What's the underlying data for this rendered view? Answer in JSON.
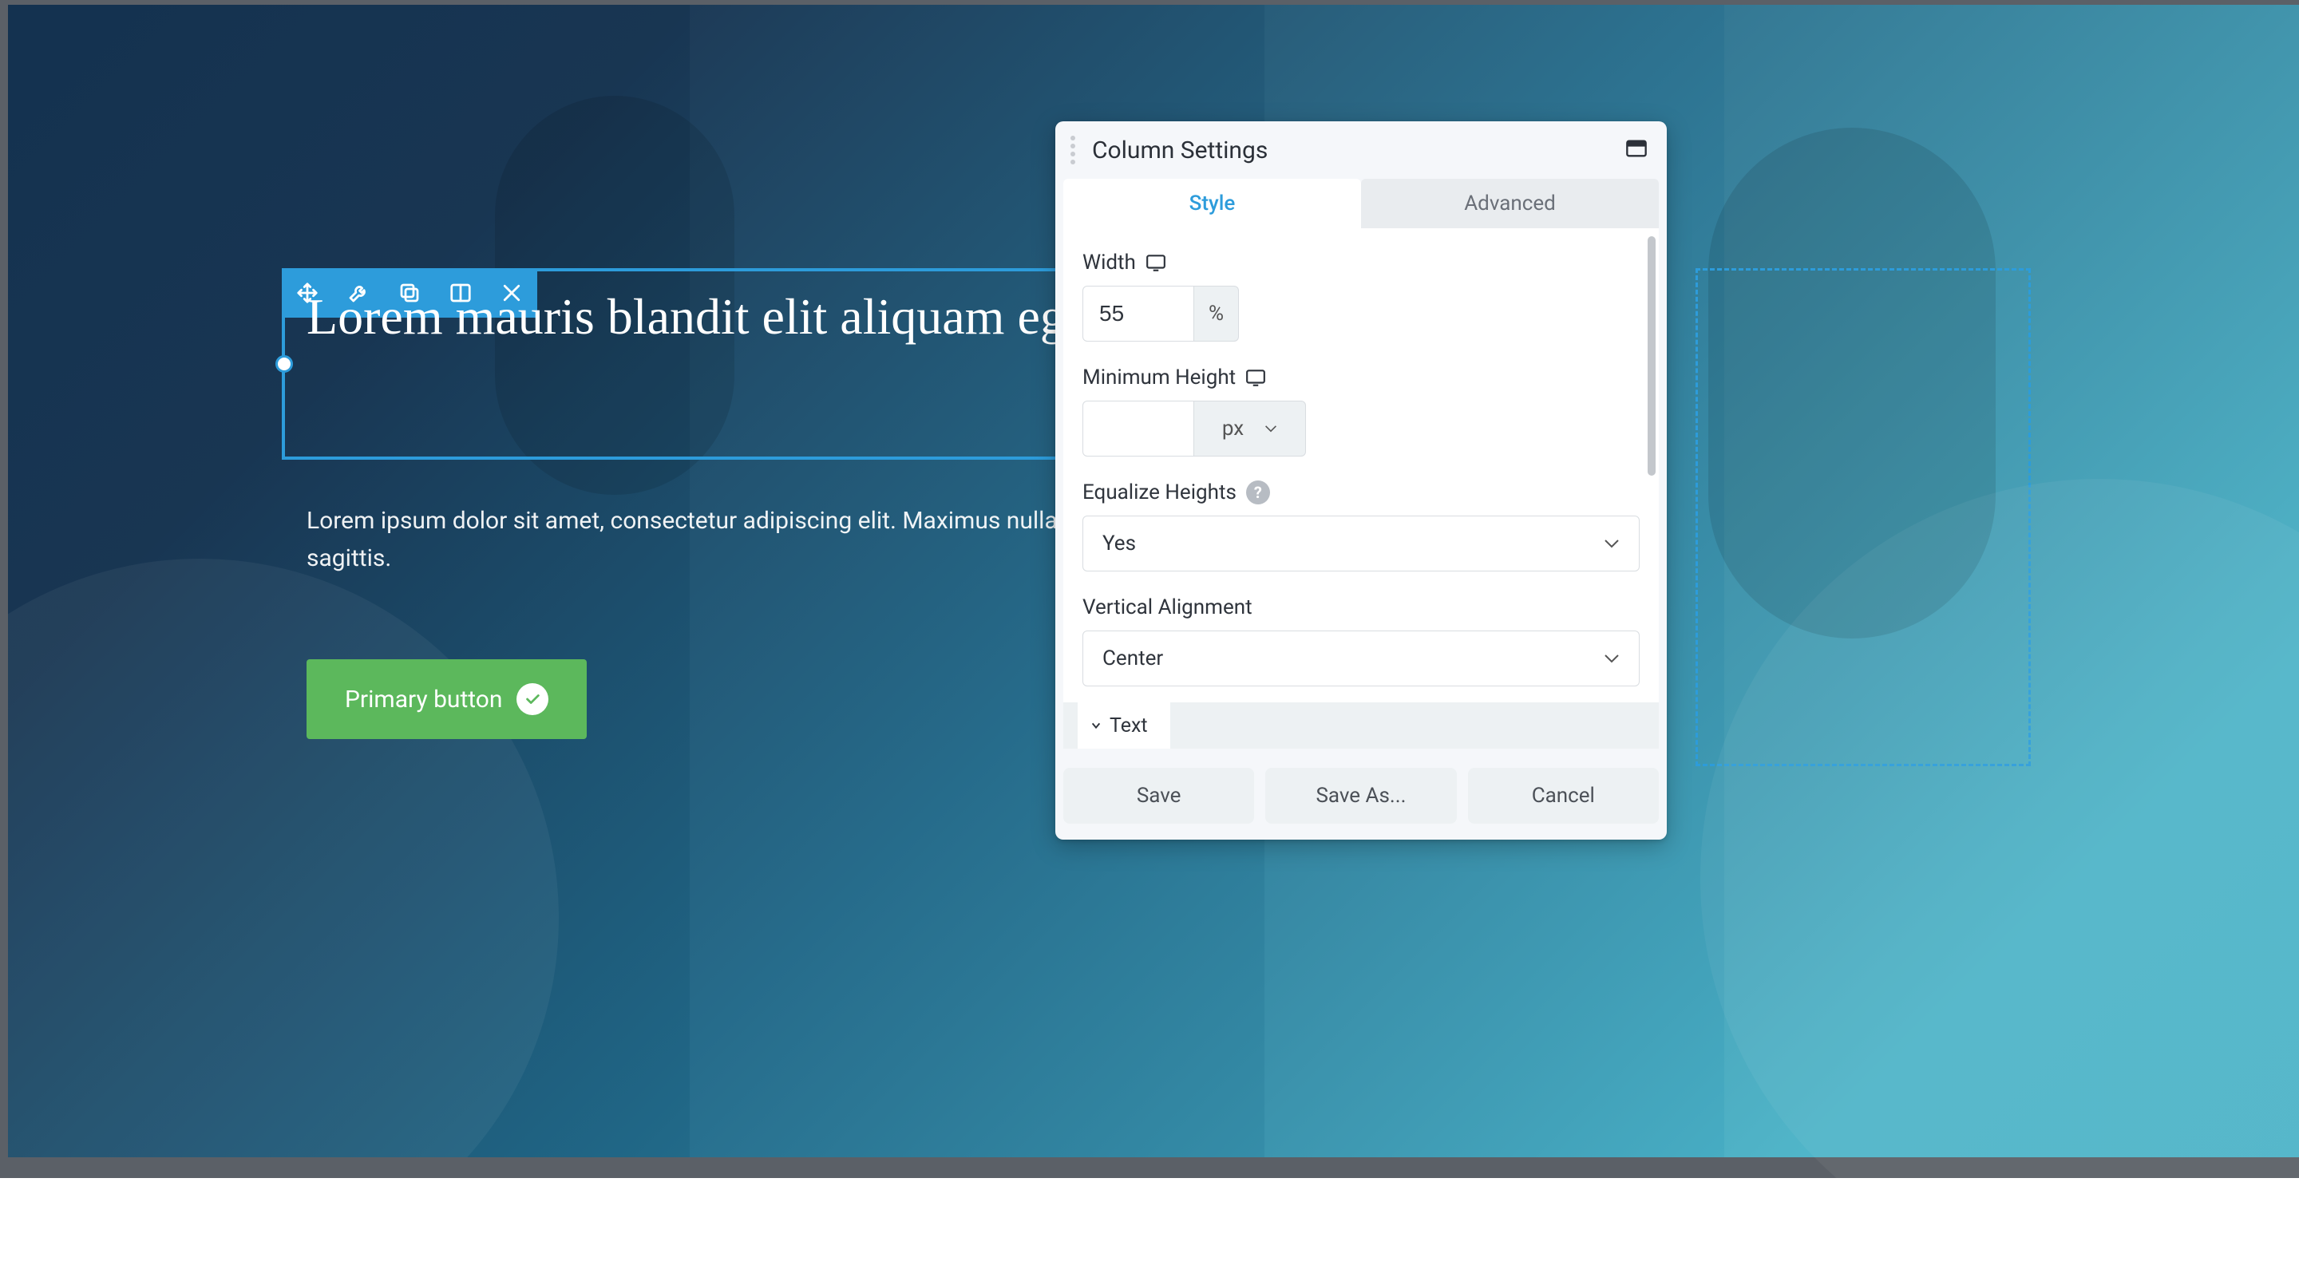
{
  "accent_color": "#2d9cdb",
  "button_color": "#5cb85c",
  "canvas": {
    "heading": "Lorem mauris blandit elit aliquam eget tincidunt",
    "paragraph": "Lorem ipsum dolor sit amet, consectetur adipiscing elit. Maximus nulla ut commodo sagittis.",
    "primary_button_label": "Primary button",
    "toolbar_icons": [
      "move-icon",
      "wrench-icon",
      "duplicate-icon",
      "column-icon",
      "close-icon"
    ]
  },
  "panel": {
    "title": "Column Settings",
    "tabs": {
      "style": "Style",
      "advanced": "Advanced"
    },
    "fields": {
      "width": {
        "label": "Width",
        "value": "55",
        "unit": "%"
      },
      "min_height": {
        "label": "Minimum Height",
        "value": "",
        "unit": "px"
      },
      "equalize_heights": {
        "label": "Equalize Heights",
        "value": "Yes"
      },
      "vertical_alignment": {
        "label": "Vertical Alignment",
        "value": "Center"
      }
    },
    "section_text": "Text",
    "footer": {
      "save": "Save",
      "save_as": "Save As...",
      "cancel": "Cancel"
    }
  }
}
